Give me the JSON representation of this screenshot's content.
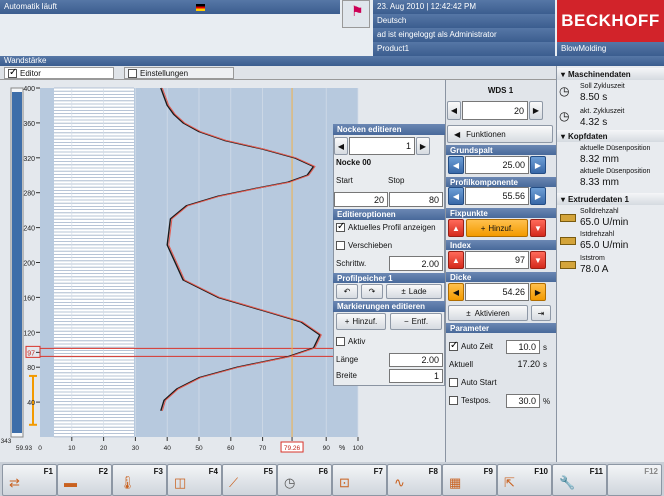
{
  "top": {
    "status": "Automatik läuft",
    "datetime": "23. Aug 2010 | 12:42:42 PM",
    "language": "Deutsch",
    "login": "ad ist eingeloggt als  Administrator",
    "product": "Product1",
    "brand": "BECKHOFF",
    "module": "BlowMolding",
    "page_title": "Wandstärke"
  },
  "tabs": [
    {
      "label": "Editor",
      "checked": true
    },
    {
      "label": "Einstellungen",
      "checked": false
    }
  ],
  "chart_data": {
    "type": "line",
    "title": "",
    "xlabel": "%",
    "x_ticks": [
      "10",
      "20",
      "30",
      "40",
      "50",
      "60",
      "70",
      "79.26",
      "90",
      "100"
    ],
    "x_ticks_left": "59.93",
    "x_origin": "343",
    "x_zero": "0",
    "y_ticks": [
      "400",
      "360",
      "320",
      "280",
      "240",
      "200",
      "160",
      "120",
      "97",
      "80",
      "40"
    ],
    "xlim": [
      0,
      100
    ],
    "ylim": [
      0,
      400
    ],
    "marker_y": 97,
    "marker_x": 79.26,
    "series": [
      {
        "x": [
          0.38,
          0.39,
          0.4,
          0.42,
          0.45,
          0.5,
          0.58,
          0.7,
          0.8,
          0.86,
          0.84,
          0.78,
          0.68,
          0.56,
          0.46,
          0.41,
          0.4,
          0.45,
          0.56,
          0.7,
          0.82,
          0.88,
          0.86,
          0.78,
          0.62,
          0.5,
          0.43,
          0.39,
          0.38
        ],
        "y": [
          400,
          390,
          380,
          370,
          360,
          350,
          340,
          330,
          320,
          310,
          300,
          292,
          285,
          276,
          265,
          250,
          220,
          180,
          160,
          145,
          132,
          117,
          102,
          92,
          80,
          68,
          55,
          42,
          30
        ]
      }
    ]
  },
  "nocken": {
    "title": "Nocken editieren",
    "value": "1",
    "name": "Nocke 00",
    "start_label": "Start",
    "stop_label": "Stop",
    "start": "20",
    "stop": "80"
  },
  "editopt": {
    "title": "Editieroptionen",
    "show_profile": "Aktuelles Profil anzeigen",
    "shift": "Verschieben",
    "step_label": "Schrittw.",
    "step": "2.00"
  },
  "profil": {
    "title": "Profilpeicher 1",
    "load": "Lade"
  },
  "marks": {
    "title": "Markierungen editieren",
    "add": "Hinzuf.",
    "remove": "Entf.",
    "active": "Aktiv",
    "length_label": "Länge",
    "length": "2.00",
    "width_label": "Breite",
    "width": "1"
  },
  "wds": {
    "title": "WDS 1",
    "value": "20",
    "functions": "Funktionen",
    "grundspalt": "Grundspalt",
    "grundspalt_val": "25.00",
    "profilkomp": "Profilkomponente",
    "profilkomp_val": "55.56",
    "fixpunkte": "Fixpunkte",
    "add": "Hinzuf.",
    "index": "Index",
    "index_val": "97",
    "dicke": "Dicke",
    "dicke_val": "54.26",
    "activate": "Aktivieren",
    "parameter": "Parameter",
    "autozeit": "Auto Zeit",
    "autozeit_val": "10.0",
    "unit_s": "s",
    "aktuell": "Aktuell",
    "aktuell_val": "17.20",
    "autostart": "Auto Start",
    "testpos": "Testpos.",
    "testpos_val": "30.0",
    "unit_pct": "%"
  },
  "sidebar": {
    "machine": "Maschinendaten",
    "soll_label": "Soll Zykluszeit",
    "soll_val": "8.50 s",
    "akt_label": "akt. Zykluszeit",
    "akt_val": "4.32 s",
    "kopf": "Kopfdaten",
    "duese1_label": "aktuelle Düsenposition",
    "duese1_val": "8.32 mm",
    "duese2_label": "aktuelle Düsenposition",
    "duese2_val": "8.33 mm",
    "extruder": "Extruderdaten 1",
    "solldreh_label": "Solldrehzahl",
    "solldreh_val": "65.0 U/min",
    "istdreh_label": "Istdrehzahl",
    "istdreh_val": "65.0 U/min",
    "iststrom_label": "Iststrom",
    "iststrom_val": "78.0 A"
  },
  "fkeys": [
    "F1",
    "F2",
    "F3",
    "F4",
    "F5",
    "F6",
    "F7",
    "F8",
    "F9",
    "F10",
    "F11",
    "F12"
  ],
  "colors": {
    "accent": "#3b5d8f",
    "curve_line": "#1a1a1a",
    "marker": "#d9342b",
    "orange": "#f39a00"
  }
}
